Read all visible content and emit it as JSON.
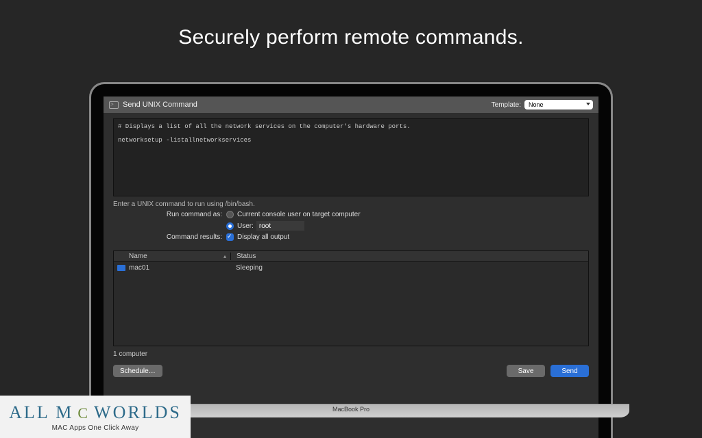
{
  "hero": {
    "title": "Securely perform remote commands."
  },
  "toolbar": {
    "window_title": "Send UNIX Command",
    "template_label": "Template:",
    "template_value": "None"
  },
  "code": {
    "line1": "# Displays a list of all the network services on the computer's hardware ports.",
    "line2": "networksetup -listallnetworkservices"
  },
  "hint": "Enter a UNIX command to run using /bin/bash.",
  "form": {
    "run_as_label": "Run command as:",
    "opt_current": "Current console user on target computer",
    "opt_user_label": "User:",
    "user_value": "root",
    "results_label": "Command results:",
    "results_opt": "Display all output"
  },
  "table": {
    "col_name": "Name",
    "col_status": "Status",
    "rows": [
      {
        "name": "mac01",
        "status": "Sleeping"
      }
    ]
  },
  "footer_count": "1 computer",
  "buttons": {
    "schedule": "Schedule…",
    "save": "Save",
    "send": "Send"
  },
  "laptop_label": "MacBook Pro",
  "watermark": {
    "brand_a": "ALL M",
    "brand_b": "WORLDS",
    "tagline": "MAC Apps One Click Away"
  }
}
